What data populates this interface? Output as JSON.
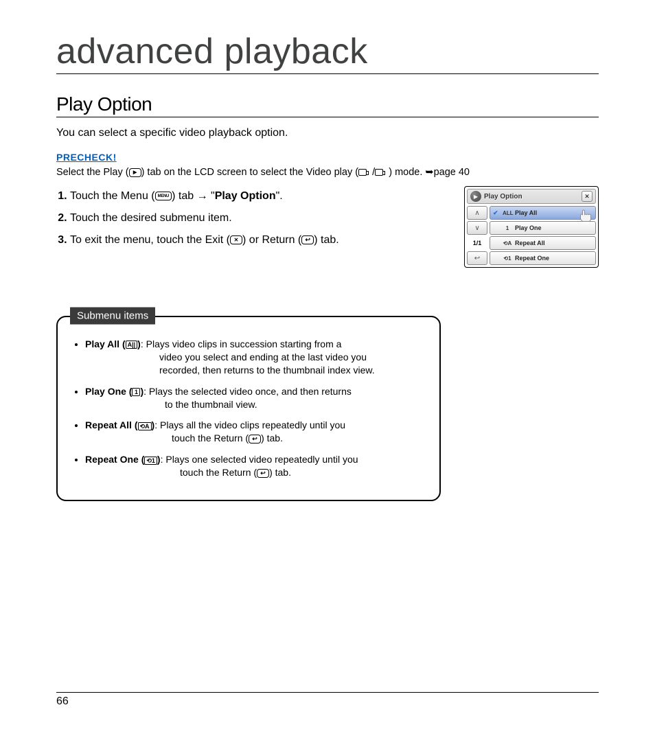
{
  "chapter_title": "advanced playback",
  "section_title": "Play Option",
  "intro": "You can select a specific video playback option.",
  "precheck": {
    "label": "PRECHECK!",
    "before_play_icon": "Select the Play (",
    "after_play_icon": ") tab on the LCD screen to select the Video play (",
    "after_cam_icons": ") mode. ",
    "page_ref": "page 40"
  },
  "steps": {
    "s1_a": "Touch the Menu (",
    "s1_b": ") tab ",
    "s1_c": " \"",
    "s1_bold": "Play Option",
    "s1_d": "\".",
    "s2": "Touch the desired submenu item.",
    "s3_a": "To exit the menu, touch the Exit (",
    "s3_b": ") or Return (",
    "s3_c": ") tab."
  },
  "menu_label": "MENU",
  "lcd": {
    "title": "Play Option",
    "page_indicator": "1/1",
    "items": [
      {
        "label": "Play All",
        "selected": true,
        "icon": "ALL"
      },
      {
        "label": "Play One",
        "selected": false,
        "icon": "1"
      },
      {
        "label": "Repeat All",
        "selected": false,
        "icon": "⟲A"
      },
      {
        "label": "Repeat One",
        "selected": false,
        "icon": "⟲1"
      }
    ]
  },
  "submenu": {
    "heading": "Submenu items",
    "items": [
      {
        "term": "Play All (",
        "glyph": "A||",
        "term_close": ")",
        "desc_first": ": Plays video clips in succession starting from a",
        "desc_rest1": "video you select and ending at the last video you",
        "desc_rest2": "recorded, then returns to the thumbnail index view."
      },
      {
        "term": "Play One (",
        "glyph": "1",
        "term_close": ")",
        "desc_first": ": Plays the selected video once, and then returns",
        "desc_rest1": "to the thumbnail view."
      },
      {
        "term": "Repeat All (",
        "glyph": "⟲A",
        "term_close": ")",
        "desc_first": ": Plays all the video clips repeatedly until you",
        "desc_rest1": "touch the Return (",
        "desc_rest1_after": ") tab."
      },
      {
        "term": "Repeat One (",
        "glyph": "⟲1",
        "term_close": ")",
        "desc_first": ": Plays one selected video repeatedly until you",
        "desc_rest1": "touch the Return (",
        "desc_rest1_after": ") tab."
      }
    ]
  },
  "page_number": "66"
}
